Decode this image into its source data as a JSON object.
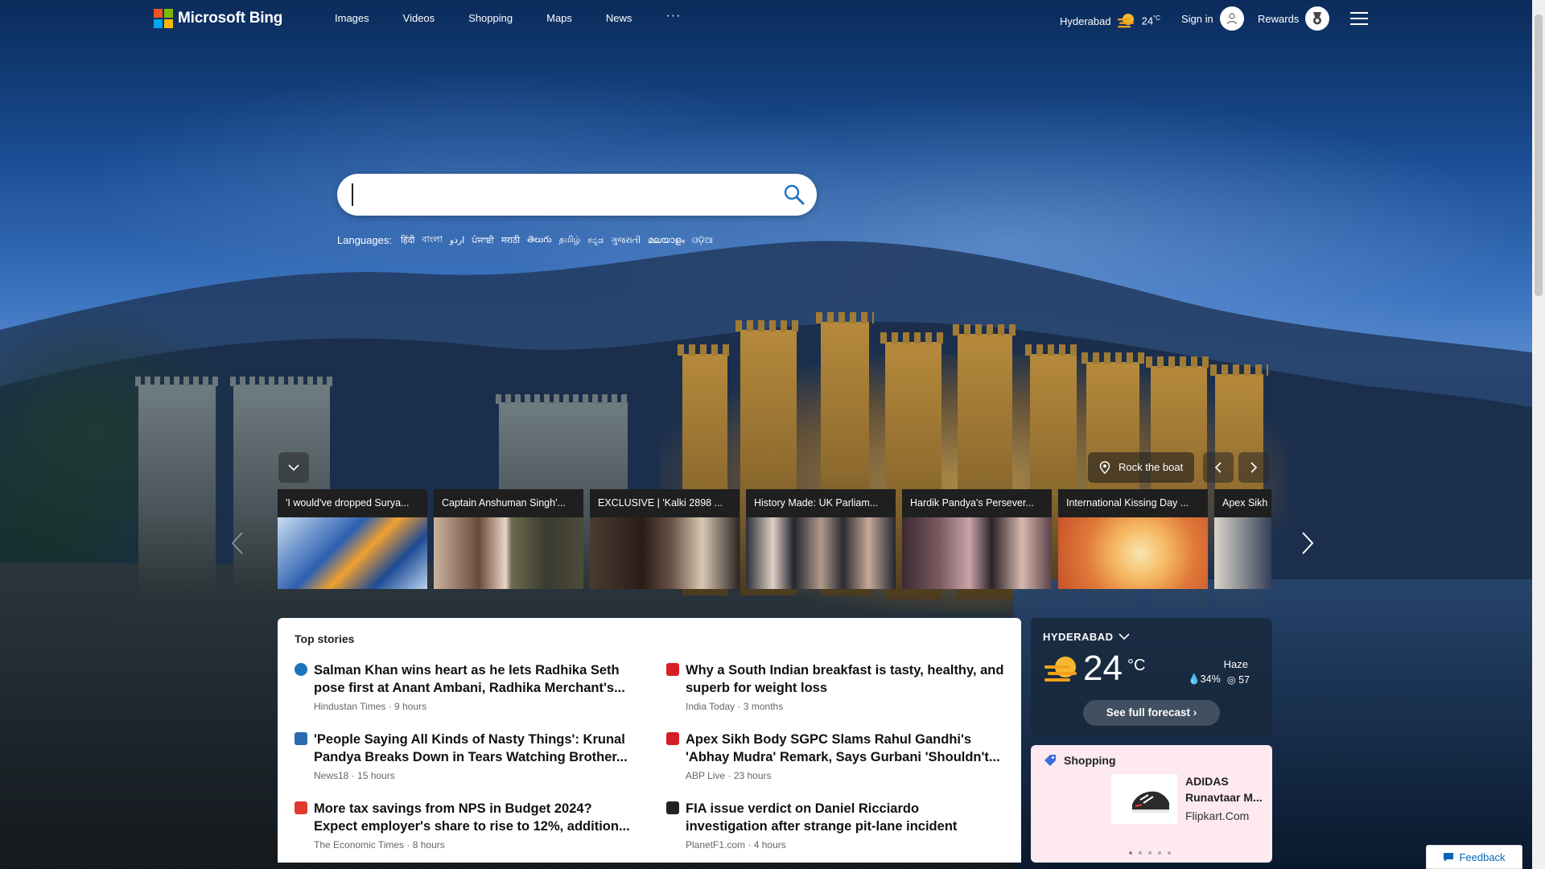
{
  "brand": {
    "name": "Microsoft Bing",
    "colors": [
      "#f25022",
      "#7fba00",
      "#00a4ef",
      "#ffb900"
    ]
  },
  "nav": {
    "items": [
      "Images",
      "Videos",
      "Shopping",
      "Maps",
      "News"
    ],
    "more": "···"
  },
  "header": {
    "city": "Hyderabad",
    "temp": "24",
    "unit": "°C",
    "signin": "Sign in",
    "rewards": "Rewards"
  },
  "search": {
    "value": "",
    "placeholder": ""
  },
  "languages": {
    "label": "Languages:",
    "items": [
      "हिंदी",
      "বাংলা",
      "اردو",
      "ਪੰਜਾਬੀ",
      "मराठी",
      "తెలుగు",
      "தமிழ்",
      "ಕನ್ನಡ",
      "ગુજરાતી",
      "മലയാളം",
      "ଓଡ଼ିଆ"
    ]
  },
  "carousel": {
    "location": "Rock the boat",
    "cards": [
      {
        "title": "'I would've dropped Surya...",
        "colors": [
          "#2a5aa8",
          "#b9d2ee"
        ]
      },
      {
        "title": "Captain Anshuman Singh'...",
        "colors": [
          "#c9a98a",
          "#3a3a30"
        ]
      },
      {
        "title": "EXCLUSIVE | 'Kalki 2898 ...",
        "colors": [
          "#3b2a22",
          "#c8b9a5"
        ]
      },
      {
        "title": "History Made: UK Parliam...",
        "colors": [
          "#23262e",
          "#8a8f9c"
        ]
      },
      {
        "title": "Hardik Pandya's Persever...",
        "colors": [
          "#3a2a30",
          "#b48f8a"
        ]
      },
      {
        "title": "International Kissing Day ...",
        "colors": [
          "#e07a3a",
          "#f5c06a"
        ]
      },
      {
        "title": "Apex Sikh",
        "colors": [
          "#2b3a55",
          "#d8c7b0"
        ]
      }
    ]
  },
  "top_stories": {
    "heading": "Top stories",
    "items": [
      {
        "headline": "Salman Khan wins heart as he lets Radhika Seth pose first at Anant Ambani, Radhika Merchant's...",
        "source": "Hindustan Times",
        "age": "9 hours",
        "icon_color": "#1b75bb"
      },
      {
        "headline": "Why a South Indian breakfast is tasty, healthy, and superb for weight loss",
        "source": "India Today",
        "age": "3 months",
        "icon_color": "#d91f26"
      },
      {
        "headline": "'People Saying All Kinds of Nasty Things': Krunal Pandya Breaks Down in Tears Watching Brother...",
        "source": "News18",
        "age": "15 hours",
        "icon_color": "#2a6ab1"
      },
      {
        "headline": "Apex Sikh Body SGPC Slams Rahul Gandhi's 'Abhay Mudra' Remark, Says Gurbani 'Shouldn't...",
        "source": "ABP Live",
        "age": "23 hours",
        "icon_color": "#d21f26"
      },
      {
        "headline": "More tax savings from NPS in Budget 2024? Expect employer's share to rise to 12%, addition...",
        "source": "The Economic Times",
        "age": "8 hours",
        "icon_color": "#e03a2f"
      },
      {
        "headline": "FIA issue verdict on Daniel Ricciardo investigation after strange pit-lane incident",
        "source": "PlanetF1.com",
        "age": "4 hours",
        "icon_color": "#222222"
      }
    ]
  },
  "weather": {
    "city": "HYDERABAD",
    "temp": "24",
    "unit": "°C",
    "condition": "Haze",
    "humidity": "34%",
    "aqi": "57",
    "forecast_label": "See full forecast"
  },
  "shopping": {
    "heading": "Shopping",
    "product": "ADIDAS Runavtaar M...",
    "store": "Flipkart.Com"
  },
  "feedback": "Feedback"
}
